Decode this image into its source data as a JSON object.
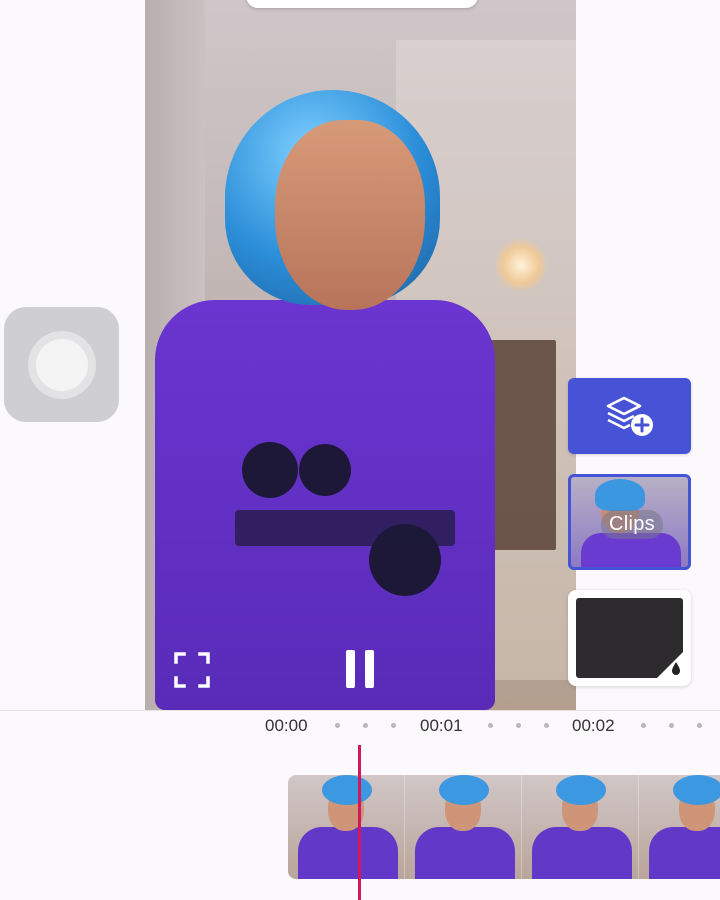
{
  "player": {
    "fullscreen_icon": "fullscreen-icon",
    "pause_icon": "pause-icon"
  },
  "panel": {
    "add_layer_icon": "add-layer-icon",
    "clips_label": "Clips",
    "background_color": "#2d2b2d",
    "accent": "#4653d6"
  },
  "timeline": {
    "time_labels": [
      "00:00",
      "00:01",
      "00:02"
    ],
    "playhead_color": "#d0185a",
    "frame_count": 4
  }
}
